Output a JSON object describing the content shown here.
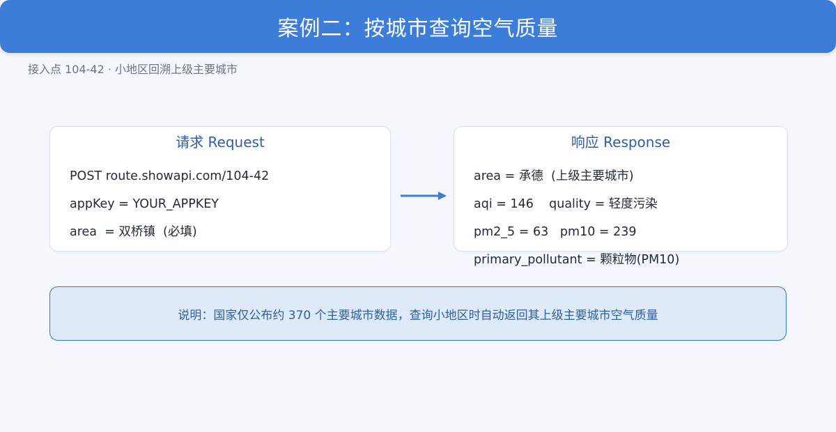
{
  "header": {
    "title": "案例二：按城市查询空气质量",
    "subtitle": "接入点 104-42 · 小地区回溯上级主要城市"
  },
  "request": {
    "title": "请求 Request",
    "lines": [
      "POST route.showapi.com/104-42",
      "appKey = YOUR_APPKEY",
      "area  = 双桥镇  (必填)"
    ]
  },
  "response": {
    "title": "响应 Response",
    "lines": [
      "area = 承德  (上级主要城市)",
      "aqi = 146    quality = 轻度污染",
      "pm2_5 = 63   pm10 = 239",
      "primary_pollutant = 颗粒物(PM10)"
    ]
  },
  "note": {
    "text": "说明：国家仅公布约 370 个主要城市数据，查询小地区时自动返回其上级主要城市空气质量"
  },
  "colors": {
    "header_bg": "#3b7dd8",
    "accent": "#2c5fa3",
    "arrow": "#3b7dd8",
    "note_bg": "#dfeaf8",
    "note_border": "#3d73bf"
  }
}
